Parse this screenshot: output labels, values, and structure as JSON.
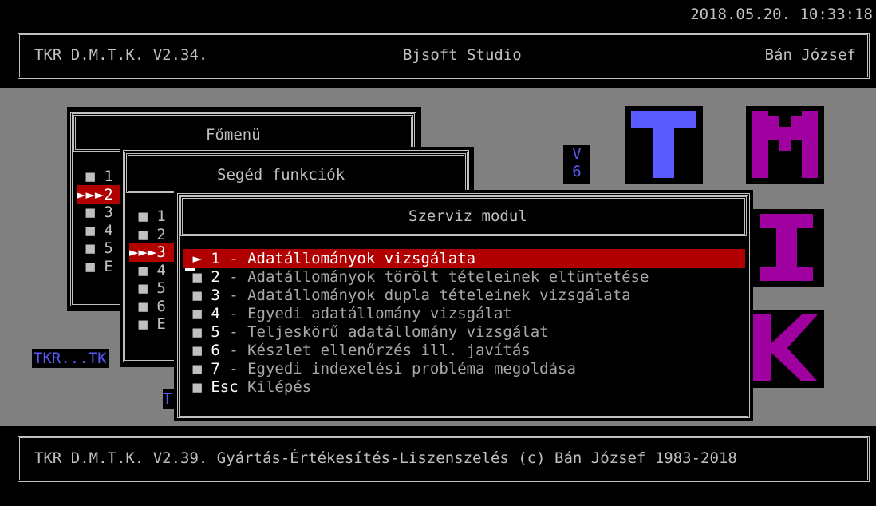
{
  "datetime": "2018.05.20. 10:33:18",
  "header": {
    "left": "TKR D.M.T.K. V2.34.",
    "center": "Bjsoft Studio",
    "right": "Bán József"
  },
  "footer": {
    "text": "TKR D.M.T.K. V2.39. Gyártás-Értékesítés-Liszenszelés (c) Bán József 1983-2018"
  },
  "main_menu": {
    "title": "Főmenü",
    "items": [
      {
        "key": "1",
        "selected": false
      },
      {
        "key": "2",
        "selected": true
      },
      {
        "key": "3",
        "selected": false
      },
      {
        "key": "4",
        "selected": false
      },
      {
        "key": "5",
        "selected": false
      },
      {
        "key": "E",
        "selected": false
      }
    ]
  },
  "helper_menu": {
    "title": "Segéd funkciók",
    "items": [
      {
        "key": "1",
        "selected": false
      },
      {
        "key": "2",
        "selected": false
      },
      {
        "key": "3",
        "selected": true
      },
      {
        "key": "4",
        "selected": false
      },
      {
        "key": "5",
        "selected": false
      },
      {
        "key": "6",
        "selected": false
      },
      {
        "key": "E",
        "selected": false
      }
    ]
  },
  "service_menu": {
    "title": "Szerviz modul",
    "items": [
      {
        "key": "1",
        "sep": " - ",
        "label": "Adatállományok vizsgálata",
        "selected": true
      },
      {
        "key": "2",
        "sep": " - ",
        "label": "Adatállományok törölt tételeinek eltüntetése",
        "selected": false
      },
      {
        "key": "3",
        "sep": " - ",
        "label": "Adatállományok dupla tételeinek vizsgálata",
        "selected": false
      },
      {
        "key": "4",
        "sep": " - ",
        "label": "Egyedi adatállomány vizsgálat",
        "selected": false
      },
      {
        "key": "5",
        "sep": " - ",
        "label": "Teljeskörű adatállomány vizsgálat",
        "selected": false
      },
      {
        "key": "6",
        "sep": " - ",
        "label": "Készlet ellenőrzés ill. javítás",
        "selected": false
      },
      {
        "key": "7",
        "sep": " - ",
        "label": "Egyedi indexelési probléma megoldása",
        "selected": false
      },
      {
        "key": "Esc",
        "sep": " ",
        "label": "Kilépés",
        "selected": false
      }
    ]
  },
  "background": {
    "version_v": "V",
    "version_6": "6",
    "tkr_label": "TKR...TK",
    "t_fragment": "T",
    "logo_letters": [
      "T",
      "M",
      "I",
      "K"
    ]
  },
  "colors": {
    "bg": "#808080",
    "select": "#b00000",
    "blue": "#5a5aff",
    "purple": "#a000a0",
    "text": "#c0c0c0"
  }
}
